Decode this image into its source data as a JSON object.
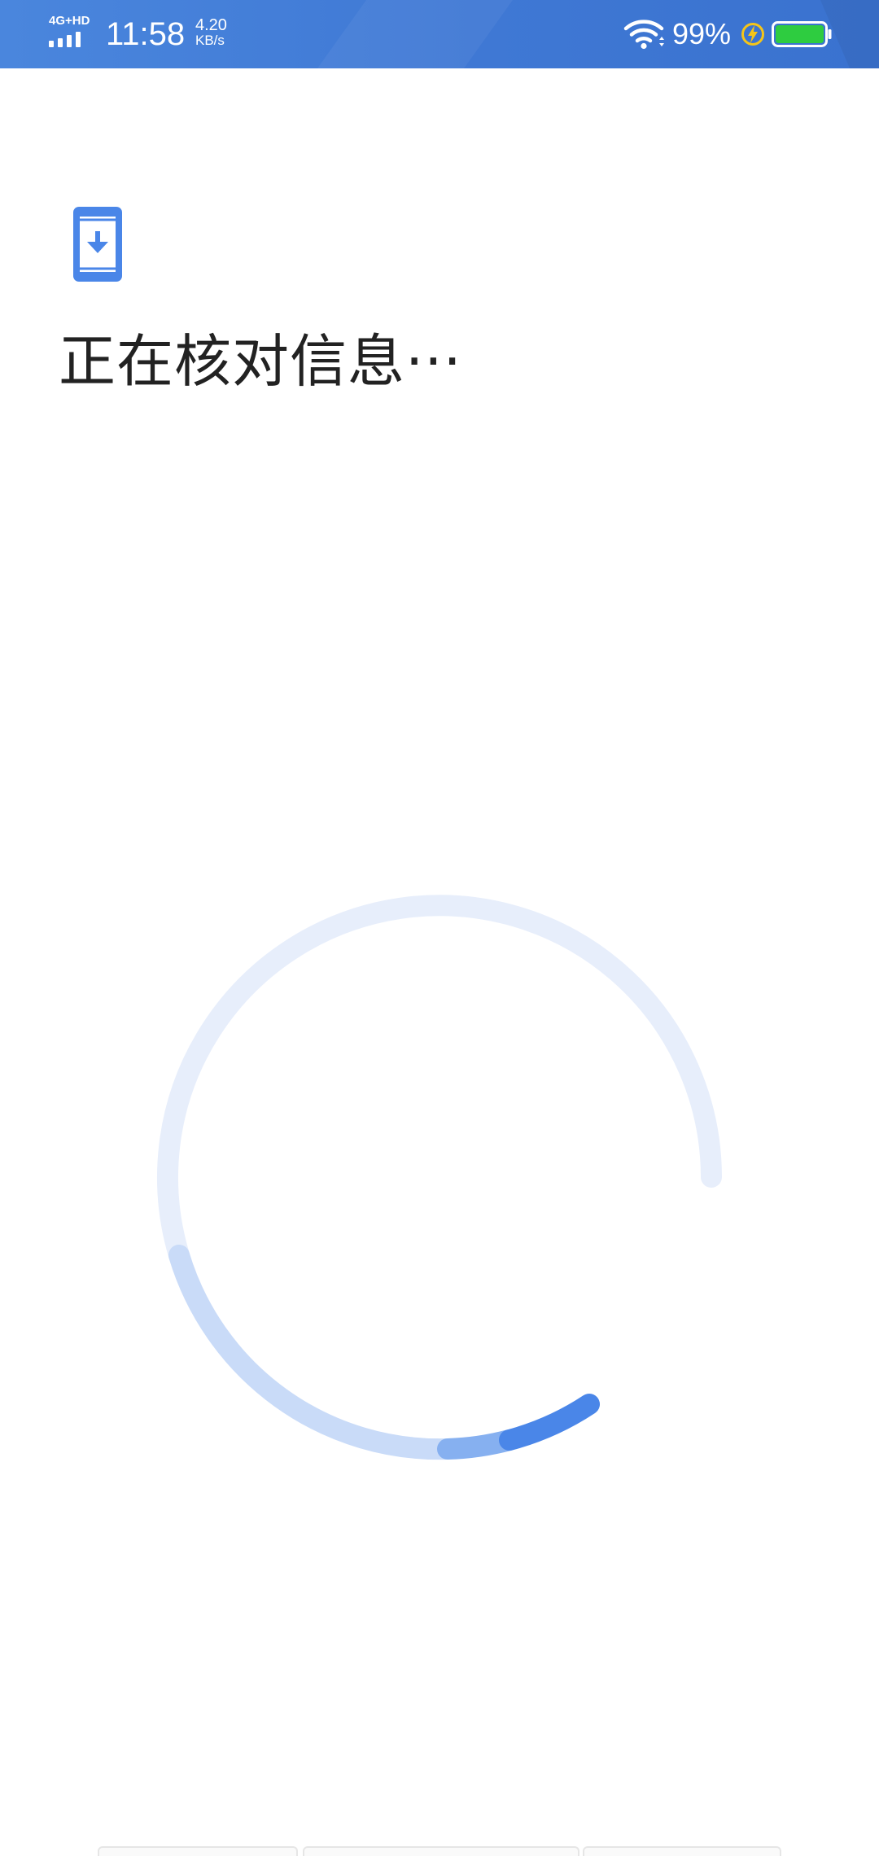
{
  "status_bar": {
    "network_type": "4G+HD",
    "time": "11:58",
    "speed_value": "4.20",
    "speed_unit": "KB/s",
    "battery_percent": "99%",
    "icons": [
      "signal-icon",
      "wifi-icon",
      "charging-icon",
      "battery-icon"
    ],
    "colors": {
      "background": "#4180d8",
      "battery_fill": "#2ecc40",
      "charge_bolt": "#f5c518"
    }
  },
  "main": {
    "header_icon": "phone-download-icon",
    "title": "正在核对信息···",
    "loading_indicator": "circular-progress-spinner",
    "colors": {
      "accent": "#4a86e8",
      "track": "#e6eefb"
    }
  }
}
